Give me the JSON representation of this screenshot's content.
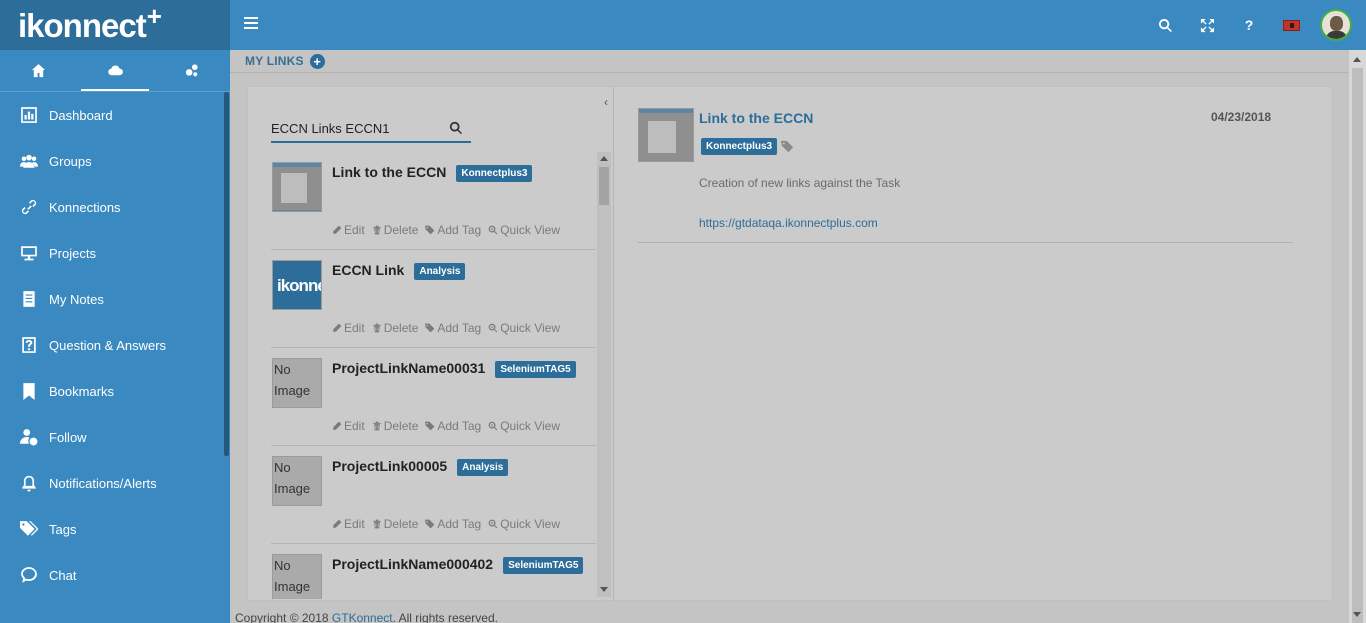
{
  "brand": {
    "name": "ikonnect",
    "plus": "+"
  },
  "sidebar_tabs": [
    {
      "icon": "home-icon",
      "active": false
    },
    {
      "icon": "cloud-icon",
      "active": true
    },
    {
      "icon": "gears-icon",
      "active": false
    }
  ],
  "nav": [
    {
      "label": "Dashboard",
      "icon": "dashboard-icon"
    },
    {
      "label": "Groups",
      "icon": "groups-icon"
    },
    {
      "label": "Konnections",
      "icon": "link-icon"
    },
    {
      "label": "Projects",
      "icon": "projects-icon"
    },
    {
      "label": "My Notes",
      "icon": "notes-icon"
    },
    {
      "label": "Question & Answers",
      "icon": "question-icon"
    },
    {
      "label": "Bookmarks",
      "icon": "bookmark-icon"
    },
    {
      "label": "Follow",
      "icon": "follow-icon"
    },
    {
      "label": "Notifications/Alerts",
      "icon": "bell-icon"
    },
    {
      "label": "Tags",
      "icon": "tags-icon"
    },
    {
      "label": "Chat",
      "icon": "chat-icon"
    }
  ],
  "topbar": {
    "help": "?"
  },
  "page": {
    "title": "MY LINKS",
    "add": "+"
  },
  "search": {
    "value": "ECCN Links ECCN1",
    "placeholder": ""
  },
  "actions": {
    "edit": "Edit",
    "delete": "Delete",
    "add_tag": "Add Tag",
    "quick_view": "Quick View"
  },
  "links": [
    {
      "title": "Link to the ECCN",
      "tag": "Konnectplus3",
      "thumb": "screenshot"
    },
    {
      "title": "ECCN Link",
      "tag": "Analysis",
      "thumb": "ikonnect-logo"
    },
    {
      "title": "ProjectLinkName00031",
      "tag": "SeleniumTAG5",
      "thumb": "No Image"
    },
    {
      "title": "ProjectLink00005",
      "tag": "Analysis",
      "thumb": "No Image"
    },
    {
      "title": "ProjectLinkName000402",
      "tag": "SeleniumTAG5",
      "thumb": "No Image"
    }
  ],
  "logo_thumb_text": "ikonnect+",
  "detail": {
    "title": "Link to the ECCN",
    "date": "04/23/2018",
    "tag": "Konnectplus3",
    "description": "Creation of new links against the Task",
    "url": "https://gtdataqa.ikonnectplus.com"
  },
  "footer": {
    "prefix": "Copyright © 2018 ",
    "link": "GTKonnect",
    "suffix": ". All rights reserved."
  },
  "colors": {
    "primary": "#3a8ac1",
    "dark": "#2c6d99",
    "overlay": "#c4c4c4"
  }
}
